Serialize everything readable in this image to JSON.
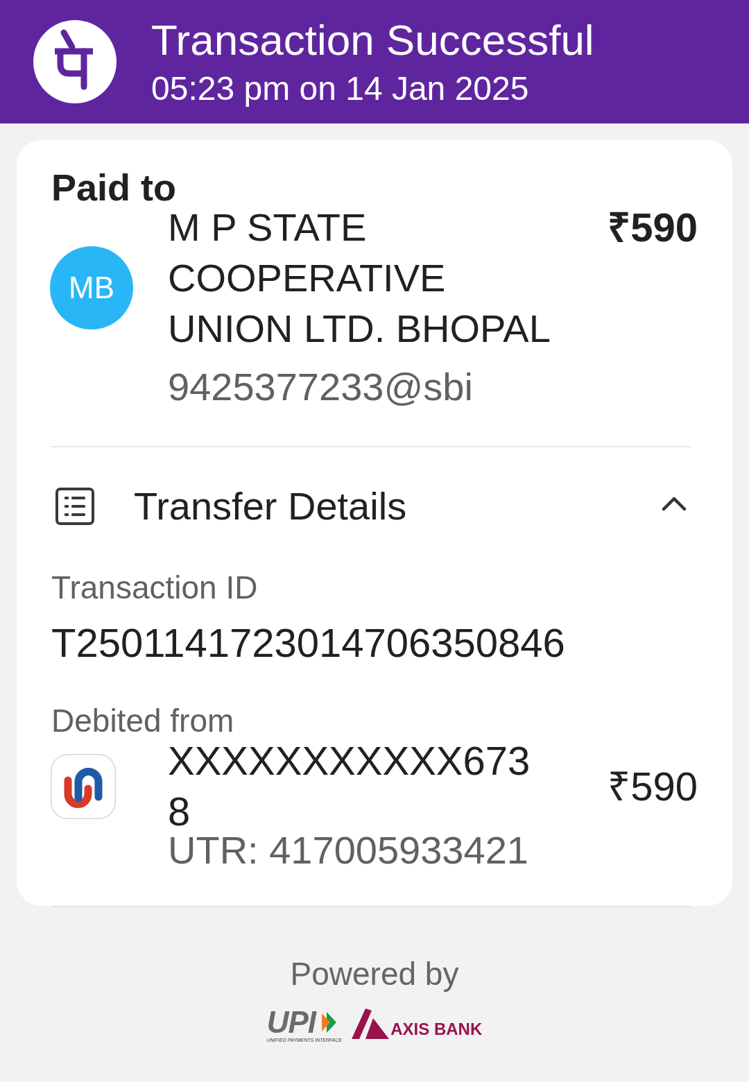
{
  "header": {
    "title": "Transaction Successful",
    "subtitle": "05:23 pm on 14 Jan 2025"
  },
  "paid_to": {
    "label": "Paid to",
    "avatar_initials": "MB",
    "name": "M P STATE COOPERATIVE UNION LTD. BHOPAL",
    "upi_id": "9425377233@sbi",
    "amount": "₹590"
  },
  "transfer_details": {
    "title": "Transfer Details",
    "expanded": true,
    "fields": [
      {
        "label": "Transaction ID",
        "value": "T2501141723014706350846"
      }
    ],
    "debited_from": {
      "label": "Debited from",
      "account": "XXXXXXXXXXX6738",
      "utr": "UTR: 417005933421",
      "amount": "₹590"
    }
  },
  "footer": {
    "powered_by": "Powered by",
    "partners": [
      {
        "kind": "upi",
        "name": "UPI",
        "tagline": "UNIFIED PAYMENTS INTERFACE"
      },
      {
        "kind": "bank",
        "name": "AXIS BANK"
      }
    ]
  }
}
